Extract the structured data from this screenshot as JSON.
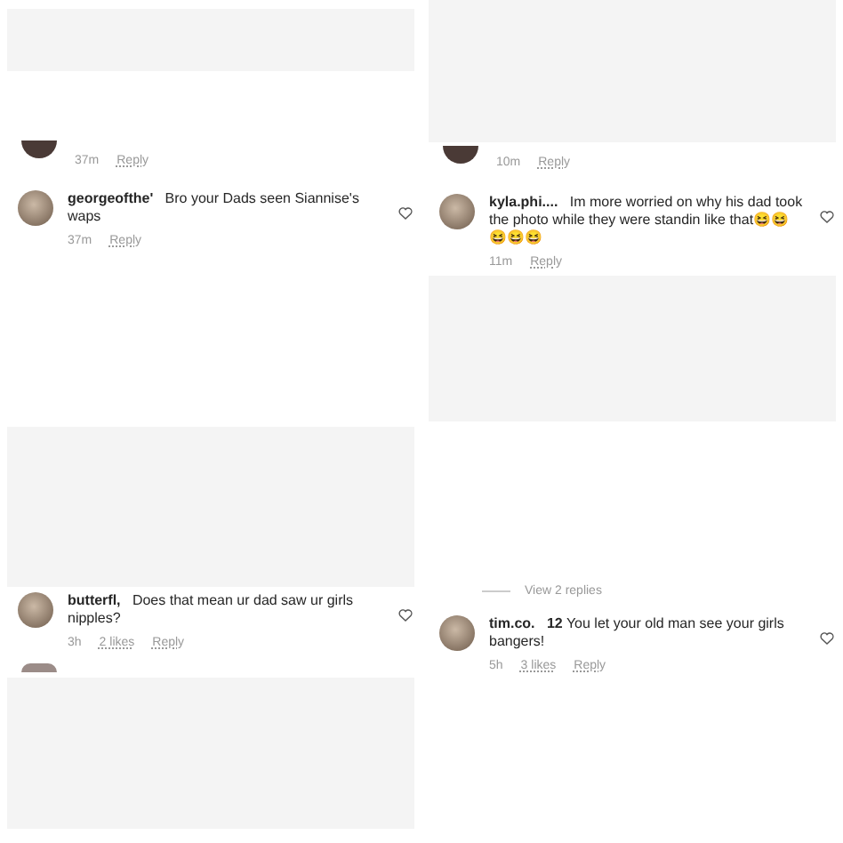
{
  "rows": [
    {
      "panels": [
        {
          "items": [
            {
              "kind": "blank"
            },
            {
              "kind": "meta",
              "avatar": true,
              "time": "37m",
              "reply": "Reply"
            },
            {
              "kind": "comment",
              "username": "georgeofthe'",
              "text": "Bro your Dads seen Siannise's waps",
              "time": "37m",
              "reply": "Reply"
            }
          ]
        },
        {
          "items": [
            {
              "kind": "blank"
            },
            {
              "kind": "meta",
              "avatar": true,
              "time": "10m",
              "reply": "Reply"
            },
            {
              "kind": "comment",
              "username": "kyla.phi....",
              "text": "Im more worried on why his dad took the photo while they were standin like that😆😆😆😆😆",
              "time": "11m",
              "reply": "Reply"
            },
            {
              "kind": "blank"
            }
          ]
        }
      ]
    },
    {
      "panels": [
        {
          "items": [
            {
              "kind": "blank"
            },
            {
              "kind": "comment",
              "username": "butterfl,",
              "text": "Does that mean ur dad saw ur girls nipples?",
              "time": "3h",
              "likes": "2 likes",
              "reply": "Reply"
            },
            {
              "kind": "stub"
            },
            {
              "kind": "blank"
            }
          ]
        },
        {
          "items": [
            {
              "kind": "replies",
              "label": "View 2 replies"
            },
            {
              "kind": "comment",
              "username": "tim.co.",
              "text": "**12** You let your old man see your girls bangers!",
              "time": "5h",
              "likes": "3 likes",
              "reply": "Reply"
            }
          ]
        }
      ]
    }
  ]
}
